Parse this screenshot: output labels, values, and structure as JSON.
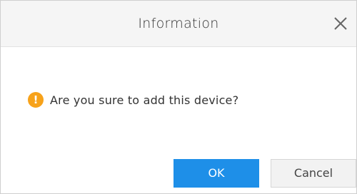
{
  "dialog": {
    "title": "Information",
    "close_icon": "close-icon",
    "message_icon": "warning-icon",
    "message_icon_glyph": "!",
    "message": "Are you sure to add this device?",
    "ok_label": "OK",
    "cancel_label": "Cancel"
  },
  "colors": {
    "primary": "#1e8fe8",
    "warning": "#f7a21a",
    "title_bar": "#f5f5f5"
  }
}
